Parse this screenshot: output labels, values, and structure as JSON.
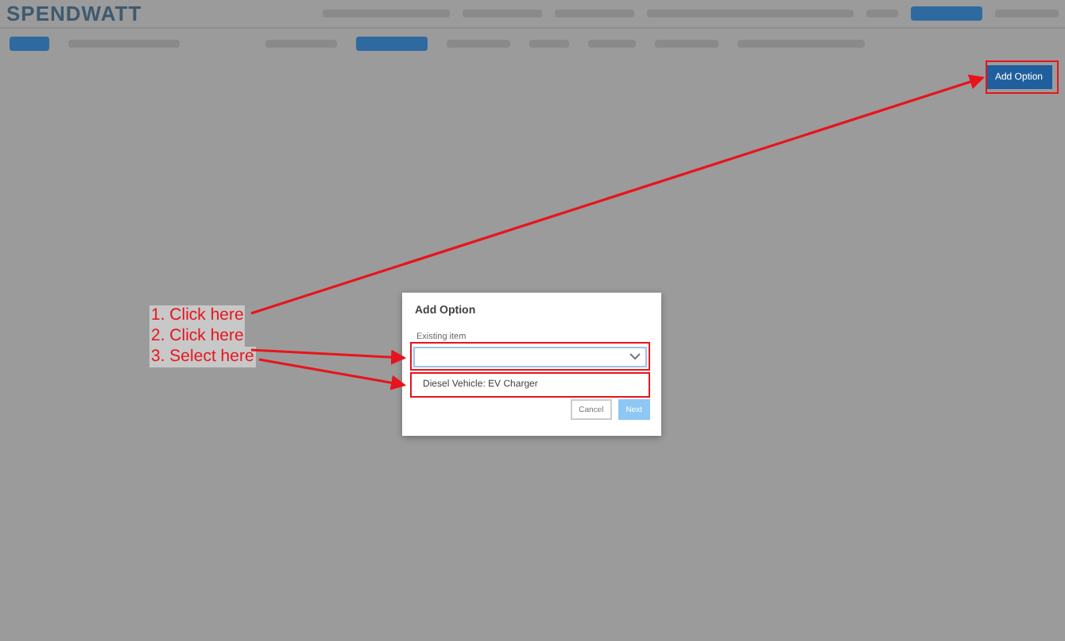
{
  "header": {
    "logo": "SPENDWATT"
  },
  "toolbar": {
    "add_button": "Add Option"
  },
  "dialog": {
    "title": "Add Option",
    "field_label": "Existing item",
    "options": [
      {
        "label": "Diesel Vehicle: EV Charger",
        "selected": false
      }
    ],
    "buttons": [
      {
        "label": "Cancel",
        "kind": "secondary"
      },
      {
        "label": "Next",
        "kind": "primary",
        "disabled": true
      }
    ]
  },
  "annotations": [
    "1. Click here",
    "2. Click here",
    "3. Select here"
  ]
}
